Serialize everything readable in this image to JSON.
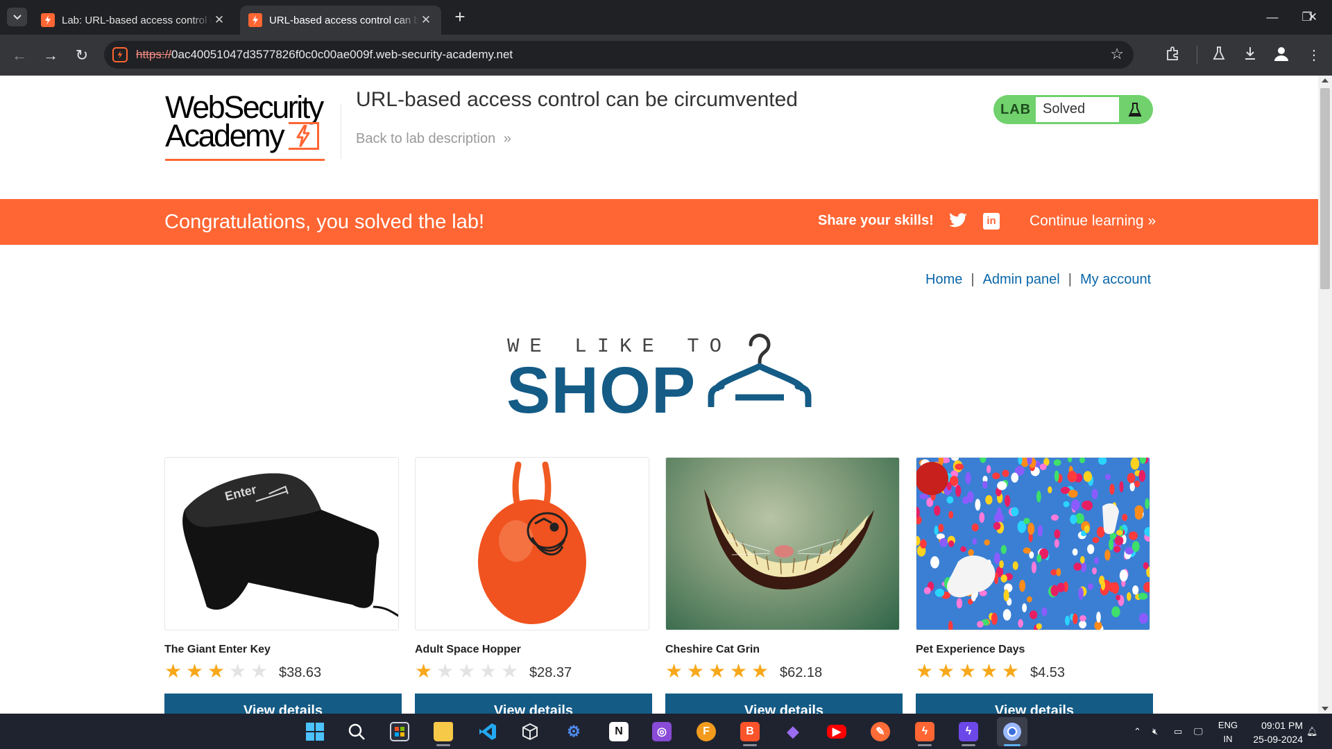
{
  "browser": {
    "tabs": [
      {
        "title": "Lab: URL-based access control can be circumvented",
        "active": false
      },
      {
        "title": "URL-based access control can be circumvented",
        "active": true
      }
    ],
    "url_scheme": "https://",
    "url_rest": "0ac40051047d3577826f0c0c00ae009f.web-security-academy.net"
  },
  "header": {
    "logo_line1": "WebSecurity",
    "logo_line2": "Academy",
    "lab_title": "URL-based access control can be circumvented",
    "back_link": "Back to lab description",
    "lab_badge_label": "LAB",
    "lab_status": "Solved"
  },
  "banner": {
    "message": "Congratulations, you solved the lab!",
    "share": "Share your skills!",
    "continue": "Continue learning"
  },
  "nav": {
    "home": "Home",
    "admin": "Admin panel",
    "account": "My account",
    "separator": "|"
  },
  "hero": {
    "line1": "WE LIKE TO",
    "line2": "SHOP"
  },
  "products": [
    {
      "name": "The Giant Enter Key",
      "rating": 3,
      "price": "$38.63",
      "button": "View details",
      "image": "giant-enter-key"
    },
    {
      "name": "Adult Space Hopper",
      "rating": 1,
      "price": "$28.37",
      "button": "View details",
      "image": "space-hopper"
    },
    {
      "name": "Cheshire Cat Grin",
      "rating": 5,
      "price": "$62.18",
      "button": "View details",
      "image": "cheshire-grin"
    },
    {
      "name": "Pet Experience Days",
      "rating": 5,
      "price": "$4.53",
      "button": "View details",
      "image": "balloon-dogs"
    }
  ],
  "taskbar": {
    "lang_line1": "ENG",
    "lang_line2": "IN",
    "time": "09:01 PM",
    "date": "25-09-2024"
  },
  "colors": {
    "accent": "#ff6633",
    "brand_blue": "#145b86",
    "solved_green": "#70d16d",
    "star": "#f8a81b"
  }
}
